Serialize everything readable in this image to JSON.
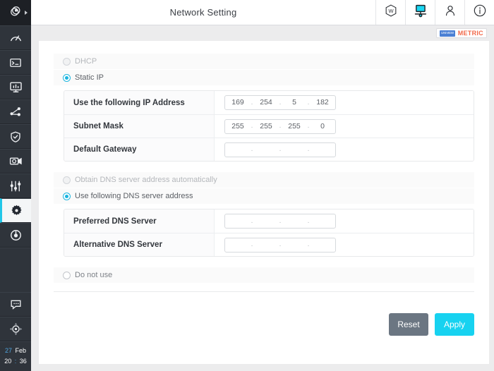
{
  "app": {
    "logo_icon": "atom-logo-icon",
    "expand_caret_icon": "caret-right-icon"
  },
  "sidebar": {
    "items": [
      {
        "name": "dashboard",
        "icon": "gauge-icon",
        "active": false
      },
      {
        "name": "terminal",
        "icon": "terminal-icon",
        "active": false
      },
      {
        "name": "monitor",
        "icon": "monitor-chart-icon",
        "active": false
      },
      {
        "name": "network-share",
        "icon": "share-nodes-icon",
        "active": false
      },
      {
        "name": "security",
        "icon": "shield-check-icon",
        "active": false
      },
      {
        "name": "camera",
        "icon": "camera-gear-icon",
        "active": false
      },
      {
        "name": "adjustments",
        "icon": "sliders-icon",
        "active": false
      },
      {
        "name": "settings",
        "icon": "gear-icon",
        "active": true
      },
      {
        "name": "record",
        "icon": "record-target-icon",
        "active": false
      }
    ],
    "bottom_items": [
      {
        "name": "messages",
        "icon": "chat-bubble-icon"
      },
      {
        "name": "ptz-control",
        "icon": "ptz-joystick-icon"
      }
    ],
    "clock": {
      "day": "27",
      "month": "Feb",
      "hour": "20",
      "separator": ":",
      "minute": "36"
    }
  },
  "header": {
    "title": "Network Setting",
    "icons": [
      {
        "name": "watermark-badge-icon",
        "label": "W"
      },
      {
        "name": "network-monitor-icon",
        "label": ""
      },
      {
        "name": "user-account-icon",
        "label": ""
      },
      {
        "name": "info-icon",
        "label": ""
      }
    ]
  },
  "metric_bar": {
    "logo_text": "UNIVIEW",
    "label": "METRIC"
  },
  "form": {
    "ip_mode": {
      "dhcp": {
        "label": "DHCP",
        "selected": false
      },
      "static": {
        "label": "Static IP",
        "selected": true
      }
    },
    "ip_rows": [
      {
        "label": "Use the following IP Address",
        "octets": [
          "169",
          "254",
          "5",
          "182"
        ]
      },
      {
        "label": "Subnet Mask",
        "octets": [
          "255",
          "255",
          "255",
          "0"
        ]
      },
      {
        "label": "Default Gateway",
        "octets": [
          "",
          "",
          "",
          ""
        ]
      }
    ],
    "dns_mode": {
      "auto": {
        "label": "Obtain DNS server address automatically",
        "selected": false
      },
      "manual": {
        "label": "Use following DNS server address",
        "selected": true
      }
    },
    "dns_rows": [
      {
        "label": "Preferred DNS Server",
        "octets": [
          "",
          "",
          "",
          ""
        ]
      },
      {
        "label": "Alternative DNS Server",
        "octets": [
          "",
          "",
          "",
          ""
        ]
      }
    ],
    "do_not_use": {
      "label": "Do not use",
      "selected": false
    },
    "buttons": {
      "reset": "Reset",
      "apply": "Apply"
    }
  },
  "colors": {
    "accent_cyan": "#17d2f0",
    "radio_on": "#19b4e0",
    "reset_gray": "#6b7682",
    "sidebar_dark": "#2f343b",
    "metric_orange": "#f2694a"
  }
}
